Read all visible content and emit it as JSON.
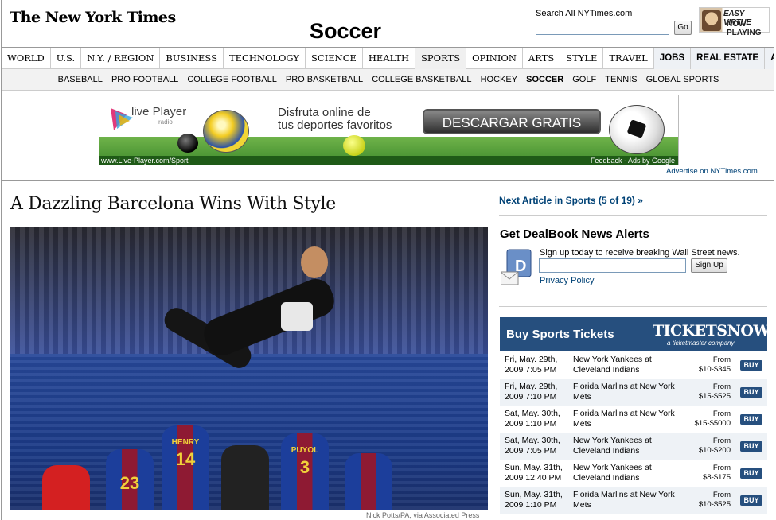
{
  "header": {
    "masthead": "The New York Times",
    "section_title": "Soccer",
    "search_label": "Search All NYTimes.com",
    "go_label": "Go",
    "ad_line1": "EASY VIRTUE",
    "ad_line2": "NOW PLAYING"
  },
  "nav": {
    "items": [
      "WORLD",
      "U.S.",
      "N.Y. / REGION",
      "BUSINESS",
      "TECHNOLOGY",
      "SCIENCE",
      "HEALTH",
      "SPORTS",
      "OPINION",
      "ARTS",
      "STYLE",
      "TRAVEL",
      "JOBS",
      "REAL ESTATE",
      "AUTOS"
    ],
    "subitems": [
      "BASEBALL",
      "PRO FOOTBALL",
      "COLLEGE FOOTBALL",
      "PRO BASKETBALL",
      "COLLEGE BASKETBALL",
      "HOCKEY",
      "SOCCER",
      "GOLF",
      "TENNIS",
      "GLOBAL SPORTS"
    ],
    "active_sub": "SOCCER"
  },
  "banner": {
    "brand": "live Player",
    "brand_sub": "radio",
    "headline_line1": "Disfruta online de",
    "headline_line2": "tus deportes favoritos",
    "cta": "DESCARGAR GRATIS",
    "url": "www.Live-Player.com/Sport",
    "ads_by": "Feedback - Ads by Google",
    "advertise": "Advertise on NYTimes.com"
  },
  "article": {
    "headline": "A Dazzling Barcelona Wins With Style",
    "photo_credit": "Nick Potts/PA, via Associated Press",
    "jersey_names": [
      "HENRY",
      "PUYOL"
    ],
    "jersey_numbers": [
      "23",
      "14",
      "3"
    ]
  },
  "sidebar": {
    "next_article": "Next Article in Sports (5 of 19) »",
    "deal_title": "Get DealBook News Alerts",
    "deal_text": "Sign up today to receive breaking Wall Street news.",
    "signup_label": "Sign Up",
    "privacy": "Privacy Policy",
    "tickets_title": "Buy Sports Tickets",
    "tickets_brand": "TICKETSNOW",
    "tickets_sub": "a ticketmaster company",
    "tickets": [
      {
        "date1": "Fri, May. 29th,",
        "date2": "2009 7:05 PM",
        "match1": "New York Yankees at",
        "match2": "Cleveland Indians",
        "from": "From",
        "price": "$10-$345",
        "buy": "BUY"
      },
      {
        "date1": "Fri, May. 29th,",
        "date2": "2009 7:10 PM",
        "match1": "Florida Marlins at New York",
        "match2": "Mets",
        "from": "From",
        "price": "$15-$525",
        "buy": "BUY"
      },
      {
        "date1": "Sat, May. 30th,",
        "date2": "2009 1:10 PM",
        "match1": "Florida Marlins at New York",
        "match2": "Mets",
        "from": "From",
        "price": "$15-$5000",
        "buy": "BUY"
      },
      {
        "date1": "Sat, May. 30th,",
        "date2": "2009 7:05 PM",
        "match1": "New York Yankees at",
        "match2": "Cleveland Indians",
        "from": "From",
        "price": "$10-$200",
        "buy": "BUY"
      },
      {
        "date1": "Sun, May. 31th,",
        "date2": "2009 12:40 PM",
        "match1": "New York Yankees at",
        "match2": "Cleveland Indians",
        "from": "From",
        "price": "$8-$175",
        "buy": "BUY"
      },
      {
        "date1": "Sun, May. 31th,",
        "date2": "2009 1:10 PM",
        "match1": "Florida Marlins at New York",
        "match2": "Mets",
        "from": "From",
        "price": "$10-$525",
        "buy": "BUY"
      }
    ]
  }
}
